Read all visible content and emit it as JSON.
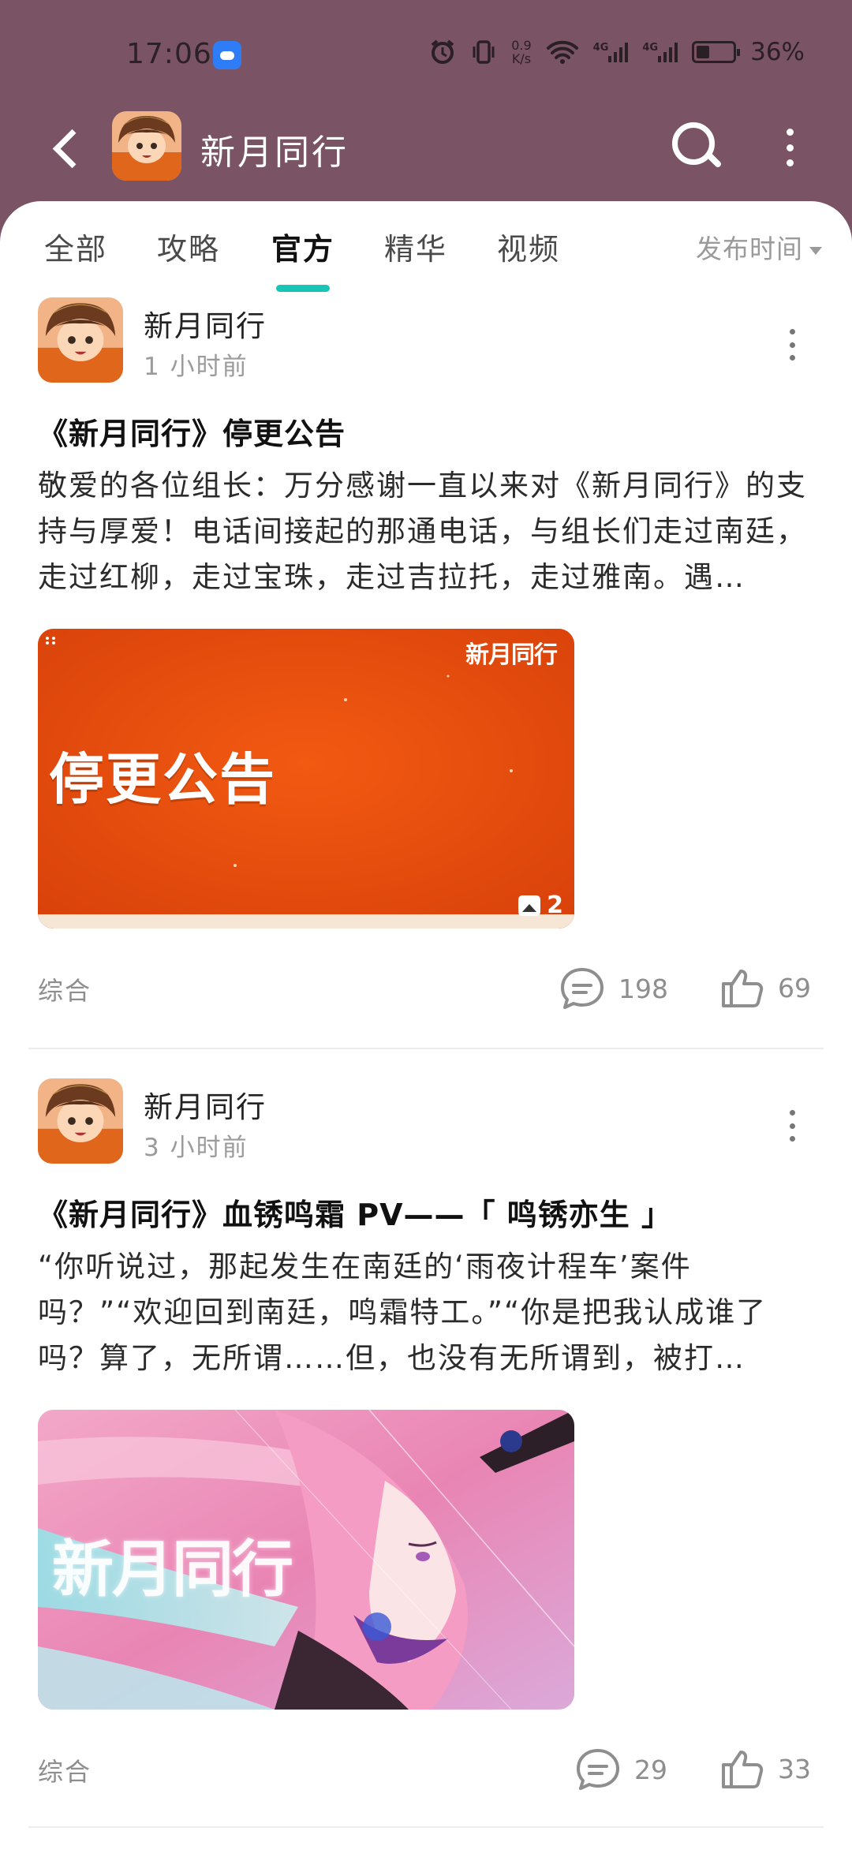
{
  "status": {
    "time": "17:06",
    "net_speed_value": "0.9",
    "net_speed_unit": "K/s",
    "signal_1": "4G",
    "signal_2": "4G",
    "battery": "36%"
  },
  "appbar": {
    "title": "新月同行",
    "icons": [
      "back-icon",
      "app-avatar",
      "search-icon",
      "more-icon"
    ]
  },
  "tabs": {
    "items": [
      "全部",
      "攻略",
      "官方",
      "精华",
      "视频"
    ],
    "active": "官方",
    "sort_label": "发布时间",
    "accent": "#18c4b3"
  },
  "posts": [
    {
      "author": "新月同行",
      "time": "1 小时前",
      "title": "《新月同行》停更公告",
      "body": "敬爱的各位组长：万分感谢一直以来对《新月同行》的支持与厚爱！电话间接起的那通电话，与组长们走过南廷，走过红柳，走过宝珠，走过吉拉托，走过雅南。遇…",
      "image_logo": "新月同行",
      "image_text": "停更公告",
      "image_count": "2",
      "tag": "综合",
      "comments": "198",
      "likes": "69"
    },
    {
      "author": "新月同行",
      "time": "3 小时前",
      "title": "《新月同行》血锈鸣霜 PV——「 鸣锈亦生 」",
      "body": "“你听说过，那起发生在南廷的‘雨夜计程车’案件吗？”“欢迎回到南廷，鸣霜特工。”“你是把我认成谁了吗？算了，无所谓……但，也没有无所谓到，被打…",
      "image_logo": "新月同行",
      "tag": "综合",
      "comments": "29",
      "likes": "33"
    }
  ],
  "colors": {
    "header_bg": "#7a5365",
    "announcement_orange": "#e8520c"
  }
}
